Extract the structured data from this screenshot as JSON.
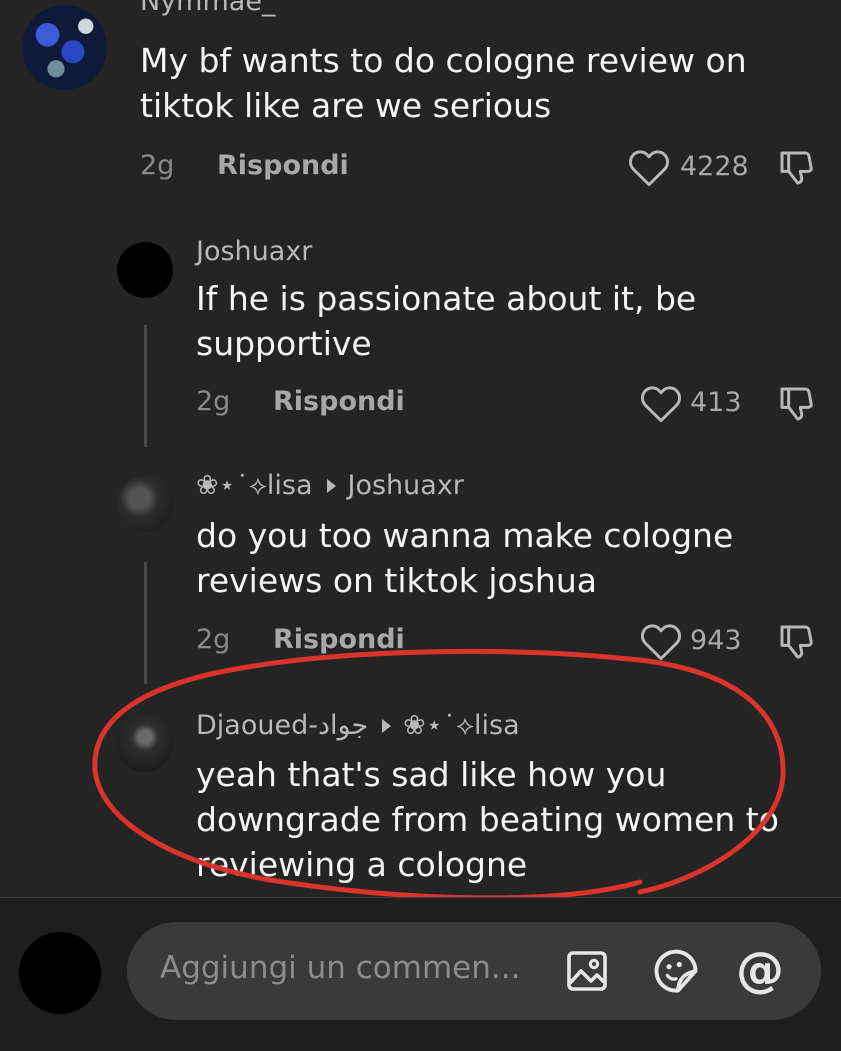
{
  "comments": [
    {
      "username": "Nymmae_",
      "text": "My bf wants to do cologne review on tiktok like are we serious",
      "time": "2g",
      "reply_label": "Rispondi",
      "likes": "4228"
    },
    {
      "username": "Joshuaxr",
      "text": "If he is passionate about it, be supportive",
      "time": "2g",
      "reply_label": "Rispondi",
      "likes": "413"
    },
    {
      "username": "❀⋆˙⟡lisa",
      "reply_to": "Joshuaxr",
      "text": "do you too wanna make cologne reviews on tiktok joshua",
      "time": "2g",
      "reply_label": "Rispondi",
      "likes": "943"
    },
    {
      "username": "Djaoued-جواد",
      "reply_to": "❀⋆˙⟡lisa",
      "text": "yeah that's sad like how you downgrade from beating women to reviewing a cologne"
    }
  ],
  "composer": {
    "placeholder": "Aggiungi un commen..."
  },
  "icons": {
    "like": "heart-icon",
    "dislike": "thumbs-down-icon",
    "image": "image-icon",
    "emoji": "emoji-sticker-icon",
    "mention": "at-mention-icon"
  },
  "colors": {
    "background": "#242424",
    "highlight_circle": "#d9342b"
  }
}
